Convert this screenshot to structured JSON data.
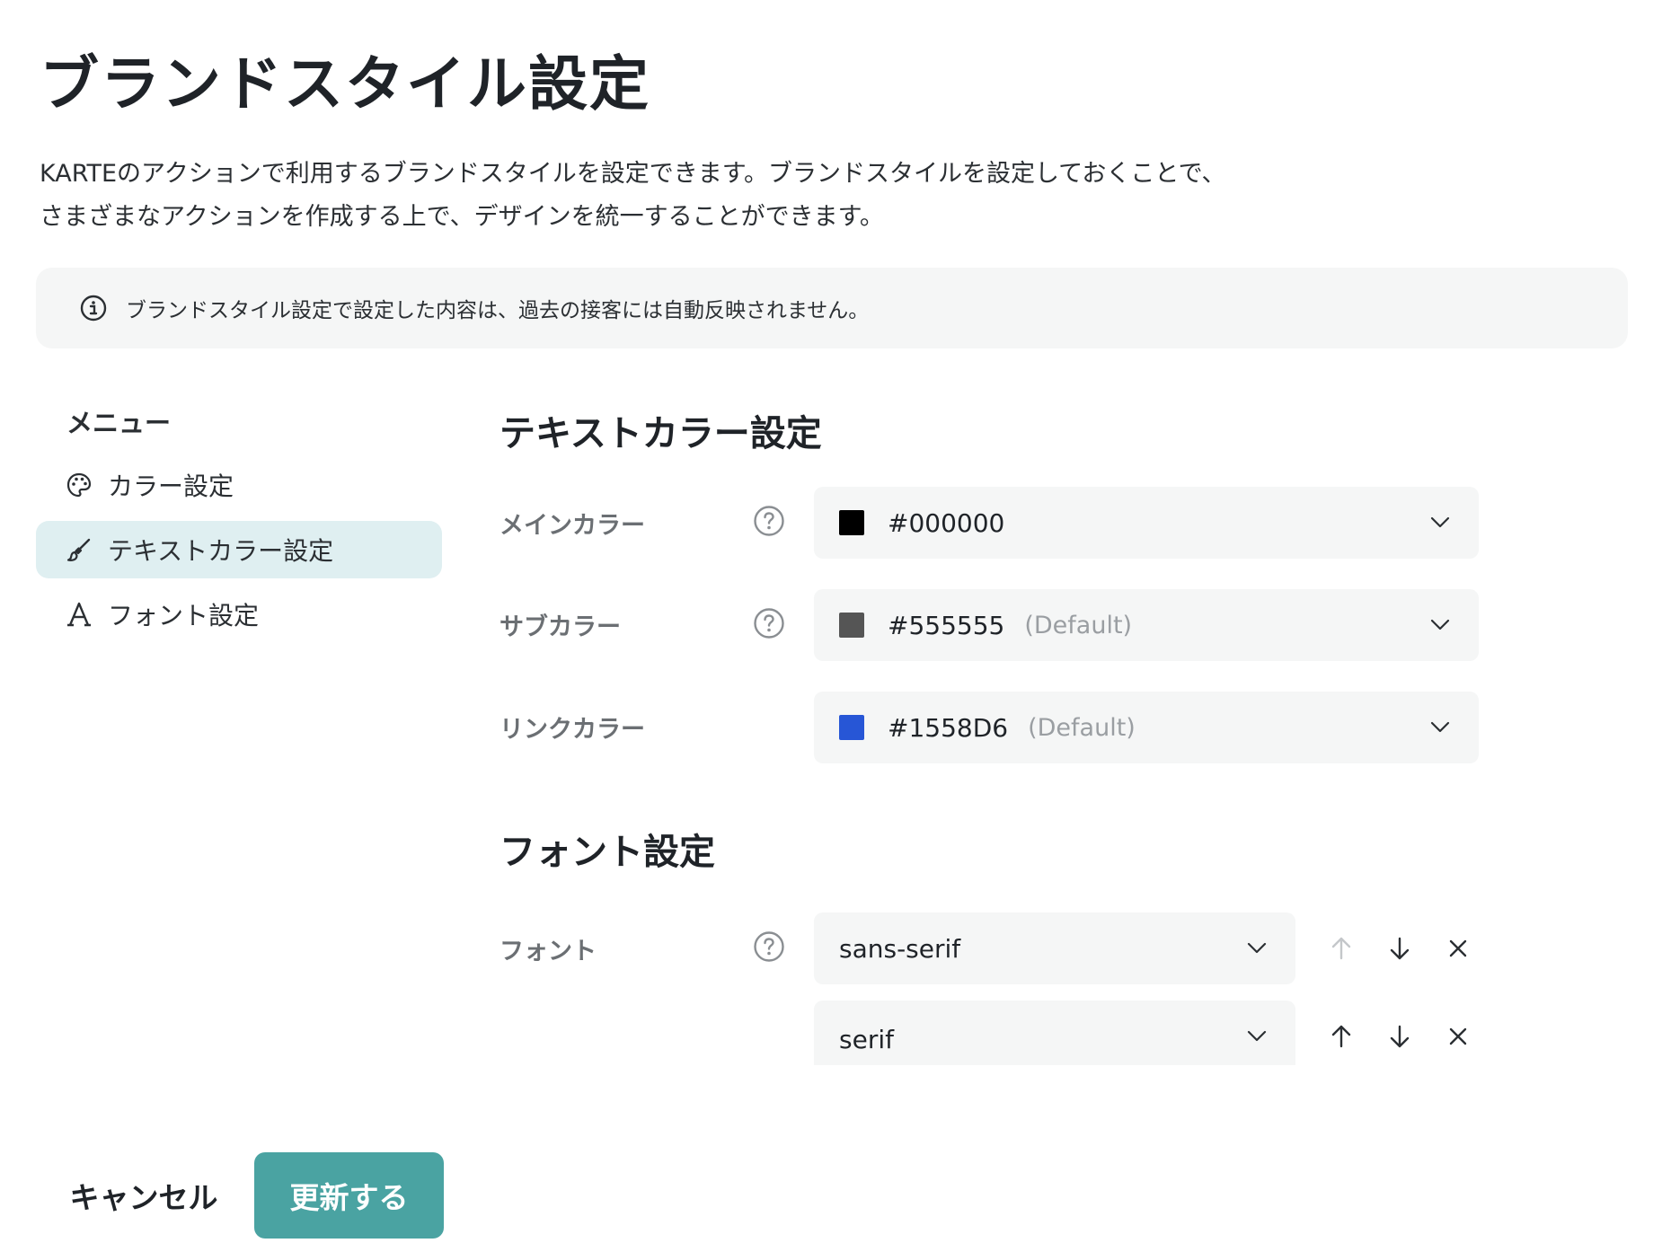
{
  "page": {
    "title": "ブランドスタイル設定",
    "description_line1": "KARTEのアクションで利用するブランドスタイルを設定できます。ブランドスタイルを設定しておくことで、",
    "description_line2": "さまざまなアクションを作成する上で、デザインを統一することができます。",
    "notice": "ブランドスタイル設定で設定した内容は、過去の接客には自動反映されません。"
  },
  "sidebar": {
    "heading": "メニュー",
    "items": [
      {
        "label": "カラー設定",
        "icon": "palette-icon",
        "active": false
      },
      {
        "label": "テキストカラー設定",
        "icon": "brush-icon",
        "active": true
      },
      {
        "label": "フォント設定",
        "icon": "font-a-icon",
        "active": false
      }
    ]
  },
  "text_color_section": {
    "title": "テキストカラー設定",
    "fields": [
      {
        "label": "メインカラー",
        "value": "#000000",
        "swatch": "#000000",
        "default_tag": "",
        "has_help": true
      },
      {
        "label": "サブカラー",
        "value": "#555555",
        "swatch": "#555555",
        "default_tag": "(Default)",
        "has_help": true
      },
      {
        "label": "リンクカラー",
        "value": "#1558D6",
        "swatch": "#2756d6",
        "default_tag": "(Default)",
        "has_help": false
      }
    ]
  },
  "font_section": {
    "title": "フォント設定",
    "label": "フォント",
    "fonts": [
      {
        "value": "sans-serif",
        "up_enabled": false,
        "down_enabled": true
      },
      {
        "value": "serif",
        "up_enabled": true,
        "down_enabled": true
      }
    ]
  },
  "actions": {
    "cancel_label": "キャンセル",
    "submit_label": "更新する"
  },
  "colors": {
    "accent": "#4aa3a2",
    "active_menu_bg": "#dfeff1",
    "panel_bg": "#f5f6f6"
  }
}
